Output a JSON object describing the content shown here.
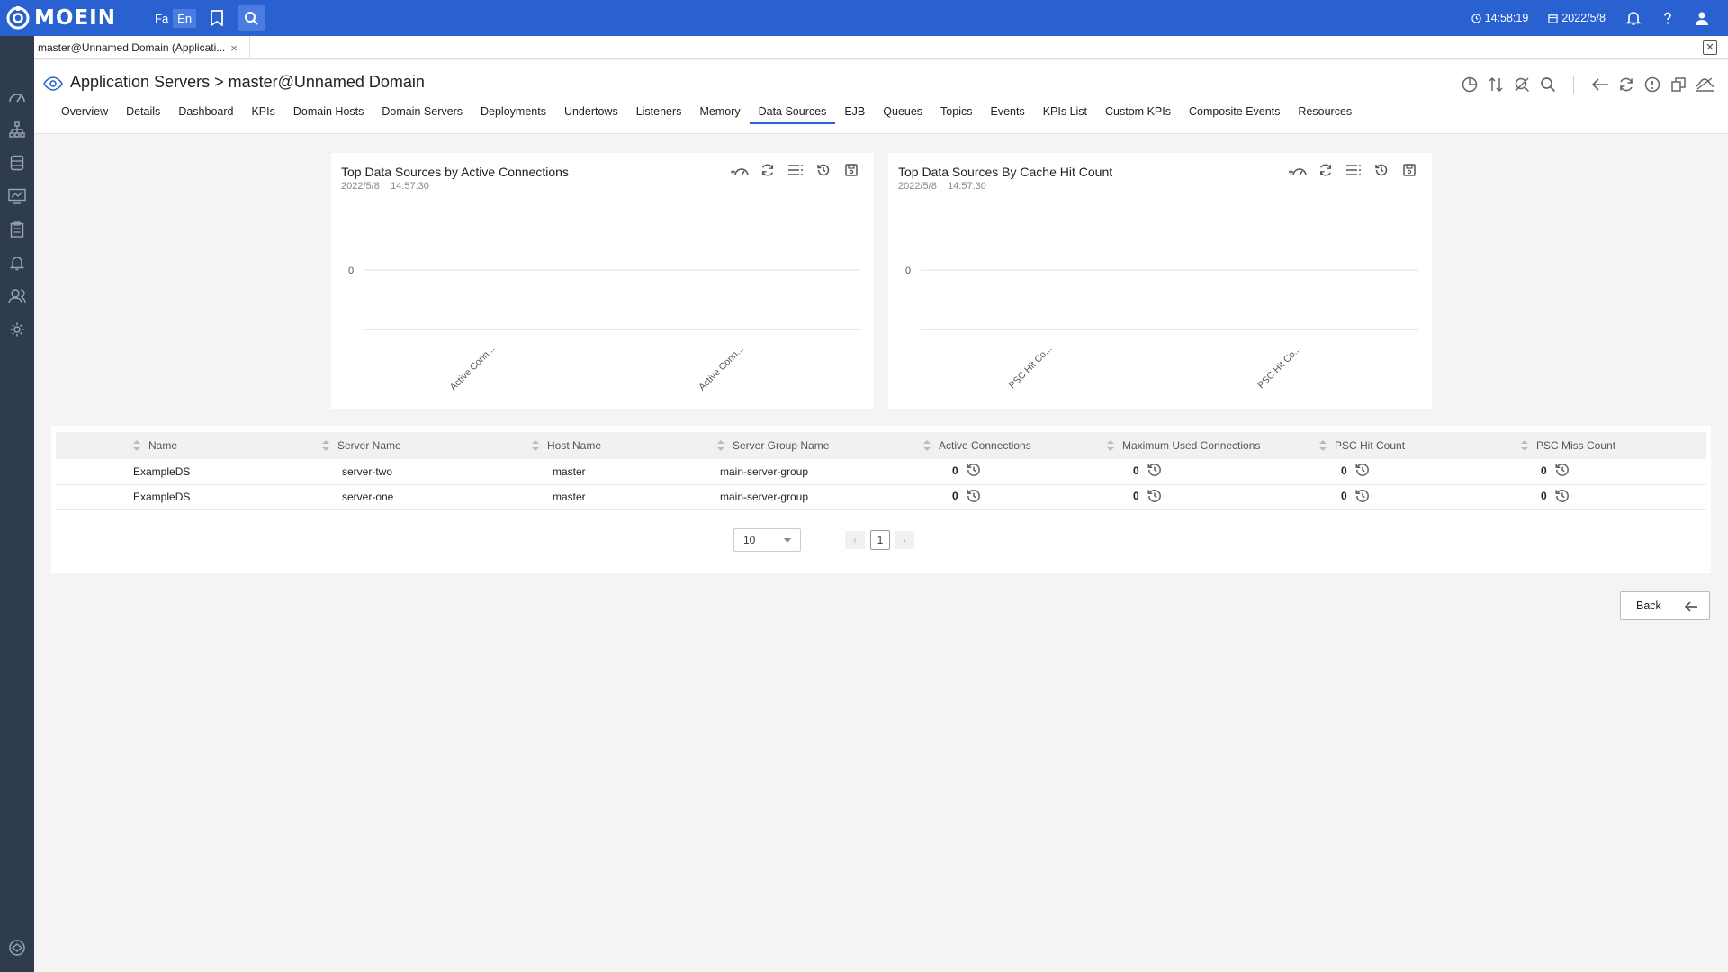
{
  "topbar": {
    "logo_text": "MOEIN",
    "lang_fa": "Fa",
    "lang_en": "En",
    "time": "14:58:19",
    "date": "2022/5/8"
  },
  "tabstrip": {
    "page_tab_label": "master@Unnamed Domain (Applicati...",
    "close": "×"
  },
  "header": {
    "title": "Application Servers > master@Unnamed Domain",
    "tabs": [
      {
        "label": "Overview"
      },
      {
        "label": "Details"
      },
      {
        "label": "Dashboard"
      },
      {
        "label": "KPIs"
      },
      {
        "label": "Domain Hosts"
      },
      {
        "label": "Domain Servers"
      },
      {
        "label": "Deployments"
      },
      {
        "label": "Undertows"
      },
      {
        "label": "Listeners"
      },
      {
        "label": "Memory"
      },
      {
        "label": "Data Sources"
      },
      {
        "label": "EJB"
      },
      {
        "label": "Queues"
      },
      {
        "label": "Topics"
      },
      {
        "label": "Events"
      },
      {
        "label": "KPIs List"
      },
      {
        "label": "Custom KPIs"
      },
      {
        "label": "Composite Events"
      },
      {
        "label": "Resources"
      }
    ],
    "active_tab": "Data Sources"
  },
  "charts": [
    {
      "title": "Top Data Sources by Active Connections",
      "date": "2022/5/8",
      "time": "14:57:30"
    },
    {
      "title": "Top Data Sources By Cache Hit Count",
      "date": "2022/5/8",
      "time": "14:57:30"
    }
  ],
  "chart_data": [
    {
      "type": "bar",
      "title": "Top Data Sources by Active Connections",
      "categories": [
        "Active Conn...",
        "Active Conn..."
      ],
      "values": [
        0,
        0
      ],
      "y_ticks": [
        "0"
      ],
      "grid": true
    },
    {
      "type": "bar",
      "title": "Top Data Sources By Cache Hit Count",
      "categories": [
        "PSC Hit Co...",
        "PSC Hit Co..."
      ],
      "values": [
        0,
        0
      ],
      "y_ticks": [
        "0"
      ],
      "grid": true
    }
  ],
  "table": {
    "headers": [
      "Name",
      "Server Name",
      "Host Name",
      "Server Group Name",
      "Active Connections",
      "Maximum Used Connections",
      "PSC Hit Count",
      "PSC Miss Count"
    ],
    "rows": [
      {
        "name": "ExampleDS",
        "server": "server-two",
        "host": "master",
        "group": "main-server-group",
        "active": "0",
        "max_used": "0",
        "psc_hit": "0",
        "psc_miss": "0"
      },
      {
        "name": "ExampleDS",
        "server": "server-one",
        "host": "master",
        "group": "main-server-group",
        "active": "0",
        "max_used": "0",
        "psc_hit": "0",
        "psc_miss": "0"
      }
    ]
  },
  "pager": {
    "page_size": "10",
    "current_page": "1",
    "prev": "‹",
    "next": "›"
  },
  "back_button": {
    "label": "Back"
  },
  "colors": {
    "primary": "#2962d0",
    "sidebar": "#2f3c4e",
    "background": "#f4f4f4"
  }
}
